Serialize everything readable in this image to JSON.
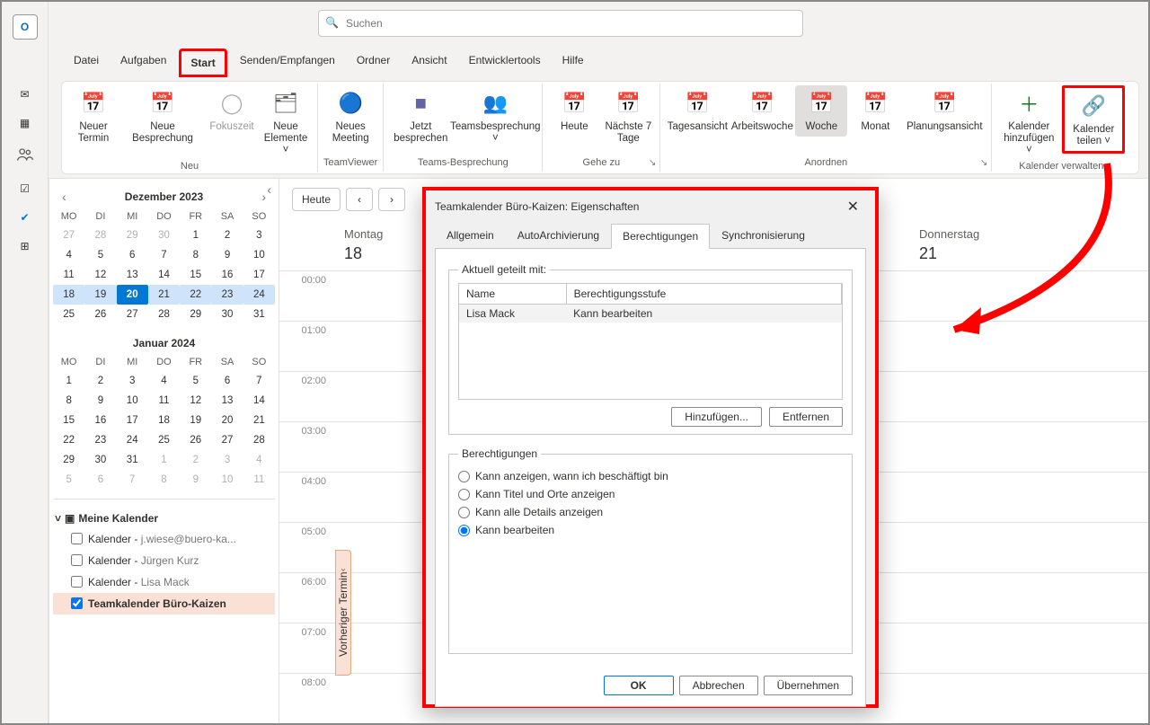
{
  "search": {
    "placeholder": "Suchen"
  },
  "ribbonTabs": [
    "Datei",
    "Aufgaben",
    "Start",
    "Senden/Empfangen",
    "Ordner",
    "Ansicht",
    "Entwicklertools",
    "Hilfe"
  ],
  "activeTab": "Start",
  "ribbon": {
    "groups": {
      "neu": {
        "label": "Neu",
        "btn1": "Neuer Termin",
        "btn2": "Neue Besprechung",
        "btn3": "Fokuszeit",
        "btn4": "Neue Elemente ˅"
      },
      "tv": {
        "label": "TeamViewer",
        "btn": "Neues Meeting"
      },
      "teams": {
        "label": "Teams-Besprechung",
        "btn1": "Jetzt besprechen",
        "btn2": "Teamsbesprechung ˅"
      },
      "gehe": {
        "label": "Gehe zu",
        "btn1": "Heute",
        "btn2": "Nächste 7 Tage"
      },
      "anordnen": {
        "label": "Anordnen",
        "btn1": "Tagesansicht",
        "btn2": "Arbeitswoche",
        "btn3": "Woche",
        "btn4": "Monat",
        "btn5": "Planungsansicht"
      },
      "verwalten": {
        "label": "Kalender verwalten",
        "btn1": "Kalender hinzufügen ˅",
        "btn2": "Kalender teilen ˅"
      }
    }
  },
  "sidebar": {
    "month1": {
      "title": "Dezember 2023",
      "dow": [
        "MO",
        "DI",
        "MI",
        "DO",
        "FR",
        "SA",
        "SO"
      ],
      "days": [
        {
          "n": 27,
          "o": 1
        },
        {
          "n": 28,
          "o": 1
        },
        {
          "n": 29,
          "o": 1
        },
        {
          "n": 30,
          "o": 1
        },
        {
          "n": 1
        },
        {
          "n": 2
        },
        {
          "n": 3
        },
        {
          "n": 4
        },
        {
          "n": 5
        },
        {
          "n": 6
        },
        {
          "n": 7
        },
        {
          "n": 8
        },
        {
          "n": 9
        },
        {
          "n": 10
        },
        {
          "n": 11
        },
        {
          "n": 12
        },
        {
          "n": 13
        },
        {
          "n": 14
        },
        {
          "n": 15
        },
        {
          "n": 16
        },
        {
          "n": 17
        },
        {
          "n": 18,
          "s": 1
        },
        {
          "n": 19,
          "s": 1
        },
        {
          "n": 20,
          "t": 1
        },
        {
          "n": 21,
          "s": 1
        },
        {
          "n": 22,
          "s": 1
        },
        {
          "n": 23,
          "s": 1
        },
        {
          "n": 24,
          "s": 1
        },
        {
          "n": 25
        },
        {
          "n": 26
        },
        {
          "n": 27
        },
        {
          "n": 28
        },
        {
          "n": 29
        },
        {
          "n": 30
        },
        {
          "n": 31
        }
      ]
    },
    "month2": {
      "title": "Januar 2024",
      "dow": [
        "MO",
        "DI",
        "MI",
        "DO",
        "FR",
        "SA",
        "SO"
      ],
      "days": [
        {
          "n": 1
        },
        {
          "n": 2
        },
        {
          "n": 3
        },
        {
          "n": 4
        },
        {
          "n": 5
        },
        {
          "n": 6
        },
        {
          "n": 7
        },
        {
          "n": 8
        },
        {
          "n": 9
        },
        {
          "n": 10
        },
        {
          "n": 11
        },
        {
          "n": 12
        },
        {
          "n": 13
        },
        {
          "n": 14
        },
        {
          "n": 15
        },
        {
          "n": 16
        },
        {
          "n": 17
        },
        {
          "n": 18
        },
        {
          "n": 19
        },
        {
          "n": 20
        },
        {
          "n": 21
        },
        {
          "n": 22
        },
        {
          "n": 23
        },
        {
          "n": 24
        },
        {
          "n": 25
        },
        {
          "n": 26
        },
        {
          "n": 27
        },
        {
          "n": 28
        },
        {
          "n": 29
        },
        {
          "n": 30
        },
        {
          "n": 31
        },
        {
          "n": 1,
          "o": 1
        },
        {
          "n": 2,
          "o": 1
        },
        {
          "n": 3,
          "o": 1
        },
        {
          "n": 4,
          "o": 1
        },
        {
          "n": 5,
          "o": 1
        },
        {
          "n": 6,
          "o": 1
        },
        {
          "n": 7,
          "o": 1
        },
        {
          "n": 8,
          "o": 1
        },
        {
          "n": 9,
          "o": 1
        },
        {
          "n": 10,
          "o": 1
        },
        {
          "n": 11,
          "o": 1
        }
      ]
    },
    "calHeader": "Meine Kalender",
    "cals": [
      {
        "label": "Kalender",
        "sub": "j.wiese@buero-ka...",
        "checked": false
      },
      {
        "label": "Kalender",
        "sub": "Jürgen Kurz",
        "checked": false
      },
      {
        "label": "Kalender",
        "sub": "Lisa Mack",
        "checked": false
      },
      {
        "label": "Teamkalender Büro-Kaizen",
        "sub": "",
        "checked": true,
        "selected": true
      }
    ]
  },
  "cal": {
    "todayBtn": "Heute",
    "days": [
      "Montag",
      "Donnerstag"
    ],
    "nums": [
      "18",
      "21"
    ],
    "hours": [
      "00:00",
      "01:00",
      "02:00",
      "03:00",
      "04:00",
      "05:00",
      "06:00",
      "07:00",
      "08:00"
    ],
    "prevTab": "Vorheriger Termin"
  },
  "dialog": {
    "title": "Teamkalender Büro-Kaizen: Eigenschaften",
    "tabs": [
      "Allgemein",
      "AutoArchivierung",
      "Berechtigungen",
      "Synchronisierung"
    ],
    "activeTab": "Berechtigungen",
    "sharedLegend": "Aktuell geteilt mit:",
    "col1": "Name",
    "col2": "Berechtigungsstufe",
    "rowName": "Lisa Mack",
    "rowPerm": "Kann bearbeiten",
    "addBtn": "Hinzufügen...",
    "removeBtn": "Entfernen",
    "permLegend": "Berechtigungen",
    "r1": "Kann anzeigen, wann ich beschäftigt bin",
    "r2": "Kann Titel und Orte anzeigen",
    "r3": "Kann alle Details anzeigen",
    "r4": "Kann bearbeiten",
    "ok": "OK",
    "cancel": "Abbrechen",
    "apply": "Übernehmen"
  }
}
